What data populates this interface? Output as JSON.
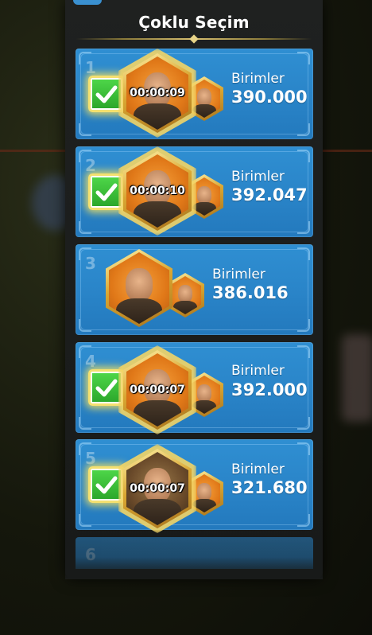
{
  "panel": {
    "title": "Çoklu Seçim"
  },
  "cards": [
    {
      "index": "1",
      "selected": true,
      "timer": "00:00:09",
      "label": "Birimler",
      "value": "390.000",
      "portrait": "commander-gold-helmet"
    },
    {
      "index": "2",
      "selected": true,
      "timer": "00:00:10",
      "label": "Birimler",
      "value": "392.047",
      "portrait": "commander-silver-helmet"
    },
    {
      "index": "3",
      "selected": false,
      "timer": "",
      "label": "Birimler",
      "value": "386.016",
      "portrait": "commander-viking"
    },
    {
      "index": "4",
      "selected": true,
      "timer": "00:00:07",
      "label": "Birimler",
      "value": "392.000",
      "portrait": "commander-queen"
    },
    {
      "index": "5",
      "selected": true,
      "timer": "00:00:07",
      "label": "Birimler",
      "value": "321.680",
      "portrait": "commander-dark-warrior"
    },
    {
      "index": "6",
      "selected": false,
      "timer": "",
      "label": "",
      "value": "",
      "portrait": ""
    }
  ],
  "icons": {
    "check": "checkmark-icon"
  },
  "colors": {
    "card": "#2a85c9",
    "checkbox": "#3cc43a",
    "gold": "#d9a632"
  }
}
